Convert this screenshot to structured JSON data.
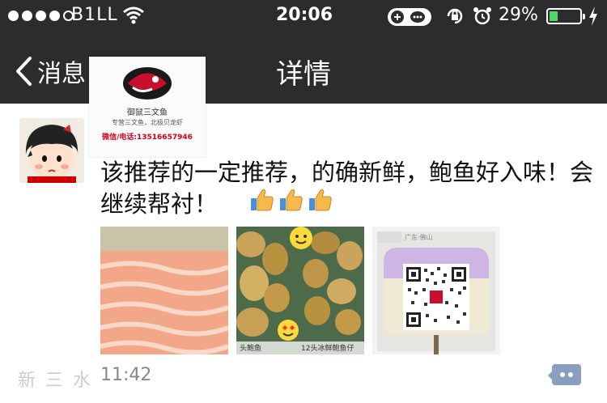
{
  "status_bar": {
    "carrier": "B1LL",
    "time": "20:06",
    "battery_percent": "29%",
    "battery_level": 0.29,
    "signal_bars": 4
  },
  "nav": {
    "back_label": "消息",
    "title": "详情"
  },
  "logo": {
    "name": "御鼠三文鱼",
    "slogan": "专营三文鱼，北极贝龙虾",
    "phone": "微信/电话:13516657946"
  },
  "post": {
    "text": "该推荐的一定推荐，的确新鲜，鲍鱼好入味！会继续帮衬！",
    "time": "11:42",
    "thumbs_count": 3,
    "photo_captions": [
      "头鲍鱼",
      "12头冰鲜鲍鱼仔"
    ],
    "qr_header": "广东·佛山"
  },
  "watermark": "新三水",
  "colors": {
    "bar_bg": "#2c2c2e",
    "battery_fill": "#4cd964",
    "comment_button": "#8a9fc0",
    "logo_red": "#d0021b"
  }
}
